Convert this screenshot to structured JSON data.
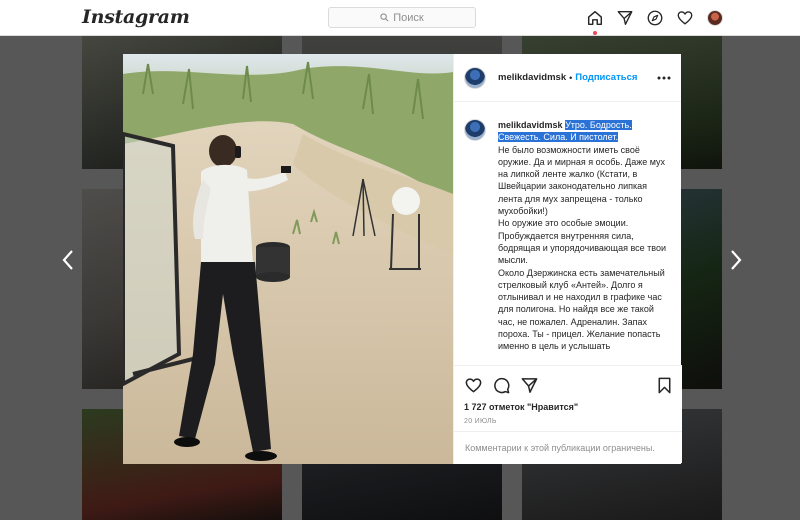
{
  "app": {
    "logo": "Instagram"
  },
  "search": {
    "placeholder": "Поиск"
  },
  "nav": {
    "icons": [
      "home-icon",
      "direct-icon",
      "explore-icon",
      "activity-icon",
      "profile-avatar"
    ]
  },
  "post": {
    "username": "melikdavidmsk",
    "separator": "•",
    "follow_label": "Подписаться",
    "caption": {
      "username": "melikdavidmsk",
      "highlighted": "Утро. Бодрость. Свежесть. Сила. И пистолет.",
      "body": "\nНе было возможности иметь своё оружие. Да и мирная я особь. Даже мух на липкой ленте жалко (Кстати, в Швейцарии законодательно липкая лента для мух запрещена - только мухобойки!)\nНо оружие это особые эмоции. Пробуждается внутренняя сила, бодрящая и упорядочивающая все твои мысли.\nОколо Дзержинска есть замечательный стрелковый клуб «Антей». Долго я отлынивал и не находил в графике час для полигона. Но найдя все же такой час, не пожалел. Адреналин. Запах пороха. Ты - прицел. Желание попасть именно в цель и услышать"
    },
    "likes_text": "1 727 отметок \"Нравится\"",
    "date": "20 ИЮЛЬ",
    "comments_disabled": "Комментарии к этой публикации ограничены."
  },
  "colors": {
    "link": "#0095f6",
    "highlight": "#2a72d6",
    "notification": "#ed4956"
  }
}
